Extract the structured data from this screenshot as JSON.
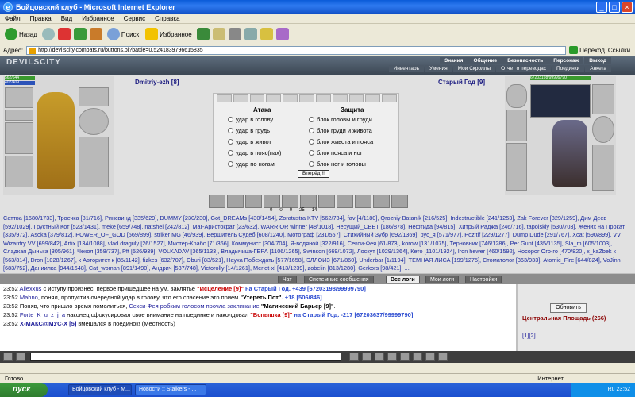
{
  "window": {
    "title": "Бойцовский клуб - Microsoft Internet Explorer"
  },
  "menu": [
    "Файл",
    "Правка",
    "Вид",
    "Избранное",
    "Сервис",
    "Справка"
  ],
  "toolbar": {
    "back": "Назад",
    "search": "Поиск",
    "favorites": "Избранное"
  },
  "address": {
    "label": "Адрес:",
    "url": "http://devilscity.combats.ru/buttons.pl?battle=0.5241839796615835",
    "go": "Переход",
    "links": "Ссылки"
  },
  "game": {
    "logo": "DEVILSCITY",
    "nav_top": [
      "Знания",
      "Общение",
      "Безопасность",
      "Персонаж",
      "Выход"
    ],
    "nav_bottom": [
      "Инвентарь",
      "Умения",
      "Мои Скроллы",
      "Отчет о переводах",
      "Поединки",
      "Анкета"
    ]
  },
  "fight": {
    "left": {
      "name": "Dmitriy-ezh [8]",
      "hp": "562/644",
      "mp": "407/409"
    },
    "right": {
      "name": "Старый Год [9]",
      "hp": "67203198/99999790"
    },
    "attack_head": "Атака",
    "defense_head": "Защита",
    "attacks": [
      "удар в голову",
      "удар в грудь",
      "удар в живот",
      "удар в пояс(пах)",
      "удар по ногам"
    ],
    "defenses": [
      "блок головы и груди",
      "блок груди и живота",
      "блок живота и пояса",
      "блок пояса и ног",
      "блок ног и головы"
    ],
    "button": "Вперёд!!!",
    "stats": [
      "0",
      "0",
      "0",
      "25",
      "14"
    ]
  },
  "players": "Саттва [1680/1733], Троечка [81/716], Ринсвинд [335/629], DUMMY [230/230], Got_DREAMs [430/1454], Zoratustra KTV [562/734], fav [4/1180], Qrozniy Batanik [216/525], Indestructible [241/1253], Zak Forever [829/1259], Дим Деев [592/1029], Грустный Кот [523/1431], meke [659/748], natshel [242/812], Mar-Аристократ [23/632], WARRIOR winner [48/1018], Несущий_СВЕТ [186/878], Нефтида [94/815], Хитрый Раджа [246/716], tapolskiy [530/703], Жених на Прокат [335/972], Asoka [379/812], POWER_OF_GOD [569/899], striker MG [46/939], Вершитель Судеб [608/1240], Мотограф [231/557], Стихийный Зубр [692/1369], рус_я [571/977], Pozitif [229/1277], Dump Dude [291/767], Xcat [590/899], VV Wizardry VV [699/842], Artix [134/1088], vlad draguly [26/1527], Мистер-Крабс [71/366], Коммунист [304/704], Я-водяной [322/916], Секси-Фея [61/873], korow [131/1075], Терновник [746/1286], Per Gunt [435/1135], Sla_m [605/1003], Сладкая Дынька [305/961], Чекол [358/737], Pft [526/939], VOLKADAV [365/1133], Владычица-ГЕРА [1106/1265], Swinson [669/1072], Лоскут [1029/1364], Кето [1101/1924], Iron hewer [460/1592], Носорог Ого-го [470/820], к_kaZbek к [563/814], Dron [1028/1267], к Авторитет к [85/1142], fizkes [632/707], Oburi [83/521], Науха Побеждать [577/1658], ЭЛЛОИЗ [671/860], Underbar [1/1194], ТЕМНАЯ ЛИСА [199/1275], Стоматолог [363/933], Atomic_Fire [644/824], VoJinn [683/752], Даниилка [944/1648], Cat_woman [891/1490], Андрич [537/748], Victorolly [14/1261], Merlot-xl [413/1239], zobelin [813/1280], Gerkors [98/421], ...",
  "chat_tabs": [
    "Чат",
    "Системные сообщения",
    "Все логи",
    "Мои логи",
    "Настройки"
  ],
  "chat": [
    {
      "t": "23:52",
      "n": "Allexxus",
      "m": " с иступу произнес, первое пришедшее на ум, заклятье ",
      "s": "\"Исцеление [9]\"",
      "r": " на Старый Год. +439 [67203198/99999790]"
    },
    {
      "t": "23:52",
      "n": "Mahno",
      "m": ", понял, пропустив очередной удар в голову, что его спасение это прием ",
      "s": "\"Утереть Пот\"",
      "r": ". +18 [506/846]"
    },
    {
      "t": "23:52",
      "n": "Поняв, что пришло время помолиться,",
      "m": " Секси-Фея робким голосом прочла заклинание ",
      "s": "\"Магический Барьер [9]\"",
      "r": "."
    },
    {
      "t": "23:52",
      "n": "Forte_K_u_z_j_a",
      "m": " наконец сфокусировал свое внимание на поединке и наколдовал ",
      "s": "\"Вспышка [9]\"",
      "r": " на Старый Год. -217 [67203637/99999790]"
    },
    {
      "t": "23:52",
      "n": "X-МАКС@МУС-Х [5]",
      "m": " вмешался в поединок! (Местность)",
      "s": "",
      "r": ""
    }
  ],
  "side": {
    "update": "Обновить",
    "place": "Центральная Площадь (266)",
    "pages": "[1][2]"
  },
  "statusbar": {
    "done": "Готово",
    "zone": "Интернет"
  },
  "taskbar": {
    "start": "пуск",
    "tasks": [
      "Бойцовский клуб - M...",
      "Новости :: Stalkers - ..."
    ],
    "lang": "Ru",
    "time": "23:52"
  },
  "colors": {
    "title_blue": "#0a5bd8",
    "name_blue": "#1a1a80",
    "hp_green": "#3a9a2e",
    "mp_blue": "#2b52b8",
    "chat_red": "#c80000"
  }
}
